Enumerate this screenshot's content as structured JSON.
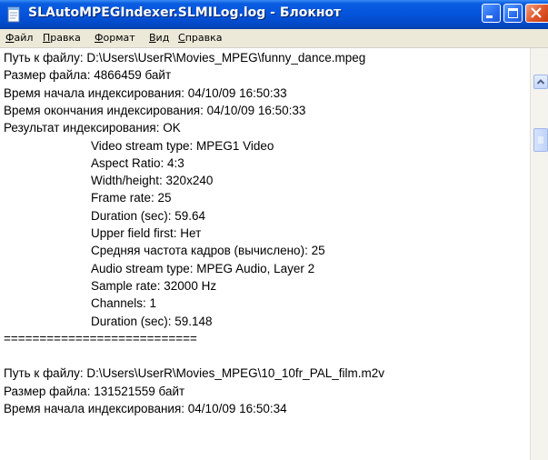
{
  "window": {
    "title": "SLAutoMPEGIndexer.SLMILog.log - Блокнот"
  },
  "menu": {
    "items": [
      "Файл",
      "Правка",
      "Формат",
      "Вид",
      "Справка"
    ]
  },
  "document": {
    "lines": [
      {
        "text": "Путь к файлу: D:\\Users\\UserR\\Movies_MPEG\\funny_dance.mpeg",
        "indent": false
      },
      {
        "text": "Размер файла: 4866459 байт",
        "indent": false
      },
      {
        "text": "Время начала индексирования: 04/10/09 16:50:33",
        "indent": false
      },
      {
        "text": "Время окончания индексирования: 04/10/09 16:50:33",
        "indent": false
      },
      {
        "text": "Результат индексирования: OK",
        "indent": false
      },
      {
        "text": "Video stream type: MPEG1 Video",
        "indent": true
      },
      {
        "text": "Aspect Ratio: 4:3",
        "indent": true
      },
      {
        "text": "Width/height: 320x240",
        "indent": true
      },
      {
        "text": "Frame rate: 25",
        "indent": true
      },
      {
        "text": "Duration (sec): 59.64",
        "indent": true
      },
      {
        "text": "Upper field first: Нет",
        "indent": true
      },
      {
        "text": "Средняя частота кадров (вычислено): 25",
        "indent": true
      },
      {
        "text": "Audio stream type: MPEG Audio, Layer 2",
        "indent": true
      },
      {
        "text": "Sample rate: 32000 Hz",
        "indent": true
      },
      {
        "text": "Channels: 1",
        "indent": true
      },
      {
        "text": "Duration (sec): 59.148",
        "indent": true
      },
      {
        "text": "===========================",
        "indent": false
      },
      {
        "text": "",
        "indent": false
      },
      {
        "text": "Путь к файлу: D:\\Users\\UserR\\Movies_MPEG\\10_10fr_PAL_film.m2v",
        "indent": false
      },
      {
        "text": "Размер файла: 131521559 байт",
        "indent": false
      },
      {
        "text": "Время начала индексирования: 04/10/09 16:50:34",
        "indent": false
      }
    ]
  },
  "icons": {
    "app": "notepad-icon",
    "minimize": "minimize-icon",
    "maximize": "maximize-icon",
    "close": "close-icon",
    "scroll_up": "arrow-up-icon",
    "scroll_thumb": "scroll-thumb-grip-icon"
  },
  "colors": {
    "titlebar": "#0453dc",
    "close_button": "#e0552a",
    "menubar": "#ece9d8"
  }
}
